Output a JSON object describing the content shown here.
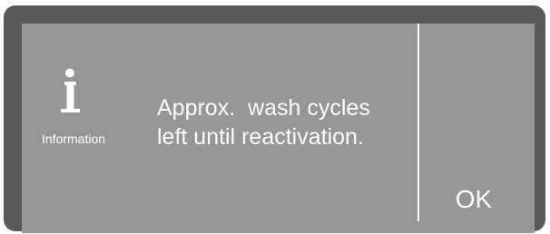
{
  "dialog": {
    "icon": "information-icon",
    "icon_label": "Information",
    "message_line1": "Approx.  wash cycles",
    "message_line2": "left until reactivation.",
    "ok_label": "OK"
  },
  "colors": {
    "bezel": "#595959",
    "screen": "#969696",
    "text": "#ffffff"
  }
}
